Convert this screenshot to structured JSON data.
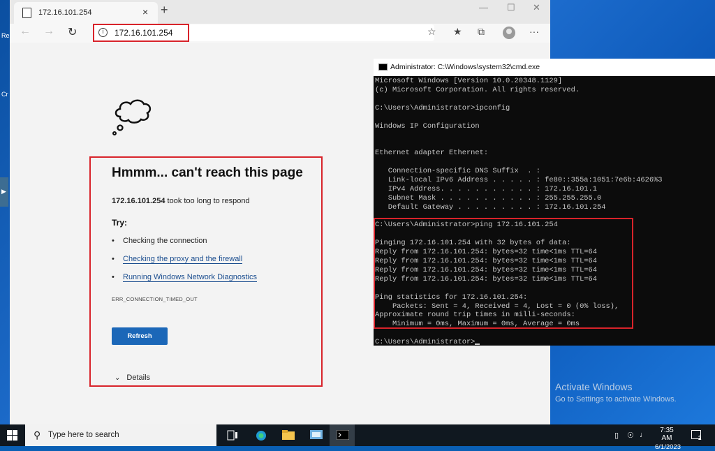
{
  "desktop": {
    "icon_label_1": "Re",
    "icon_label_2": "Cr",
    "side_tab": "▶",
    "activation_title": "Activate Windows",
    "activation_subtitle": "Go to Settings to activate Windows."
  },
  "browser": {
    "tab_title": "172.16.101.254",
    "tab_close": "×",
    "new_tab": "+",
    "minimize": "—",
    "maximize": "☐",
    "close": "✕",
    "back": "←",
    "forward": "→",
    "reload": "↻",
    "info": "i",
    "url": "172.16.101.254",
    "favorite": "☆",
    "favorites_list": "★",
    "collections": "⧉",
    "more": "···"
  },
  "error_page": {
    "title": "Hmmm... can't reach this page",
    "host": "172.16.101.254",
    "desc_suffix": " took too long to respond",
    "try_label": "Try:",
    "suggestions": [
      "Checking the connection",
      "Checking the proxy and the firewall",
      "Running Windows Network Diagnostics"
    ],
    "bullet": "•",
    "error_code": "ERR_CONNECTION_TIMED_OUT",
    "refresh_label": "Refresh",
    "details_label": "Details",
    "details_chevron": "⌄"
  },
  "cmd": {
    "title": "Administrator: C:\\Windows\\system32\\cmd.exe",
    "lines": [
      "Microsoft Windows [Version 10.0.20348.1129]",
      "(c) Microsoft Corporation. All rights reserved.",
      "",
      "C:\\Users\\Administrator>ipconfig",
      "",
      "Windows IP Configuration",
      "",
      "",
      "Ethernet adapter Ethernet:",
      "",
      "   Connection-specific DNS Suffix  . :",
      "   Link-local IPv6 Address . . . . . : fe80::355a:1051:7e6b:4626%3",
      "   IPv4 Address. . . . . . . . . . . : 172.16.101.1",
      "   Subnet Mask . . . . . . . . . . . : 255.255.255.0",
      "   Default Gateway . . . . . . . . . : 172.16.101.254",
      "",
      "C:\\Users\\Administrator>ping 172.16.101.254",
      "",
      "Pinging 172.16.101.254 with 32 bytes of data:",
      "Reply from 172.16.101.254: bytes=32 time<1ms TTL=64",
      "Reply from 172.16.101.254: bytes=32 time<1ms TTL=64",
      "Reply from 172.16.101.254: bytes=32 time<1ms TTL=64",
      "Reply from 172.16.101.254: bytes=32 time<1ms TTL=64",
      "",
      "Ping statistics for 172.16.101.254:",
      "    Packets: Sent = 4, Received = 4, Lost = 0 (0% loss),",
      "Approximate round trip times in milli-seconds:",
      "    Minimum = 0ms, Maximum = 0ms, Average = 0ms",
      "",
      "C:\\Users\\Administrator>"
    ]
  },
  "taskbar": {
    "search_placeholder": "Type here to search",
    "time": "7:35 AM",
    "date": "6/1/2023",
    "notification_count": "2"
  },
  "colors": {
    "highlight": "#d8232a",
    "accent_button": "#1b67b8",
    "link": "#1a4d8f"
  }
}
